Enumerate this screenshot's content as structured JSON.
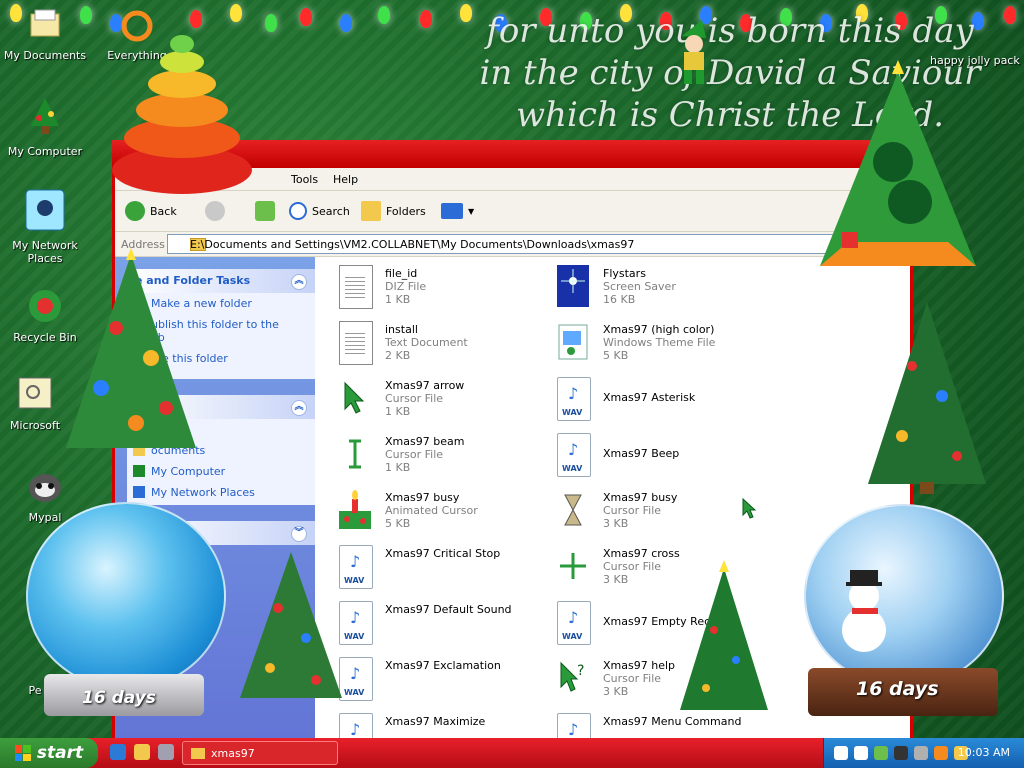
{
  "desktop": {
    "verse_lines": [
      "for unto you is born this day",
      "in the city of David a Saviour",
      "which is Christ the Lord."
    ],
    "jolly_label": "happy jolly pack",
    "icons": [
      {
        "label": "My Documents",
        "icon": "documents-icon"
      },
      {
        "label": "Everything",
        "icon": "everything-icon"
      },
      {
        "label": "My Computer",
        "icon": "computer-icon"
      },
      {
        "label": "My Network Places",
        "icon": "network-icon"
      },
      {
        "label": "Recycle Bin",
        "icon": "recycle-bin-icon"
      },
      {
        "label": "Microsoft",
        "icon": "microsoft-icon"
      },
      {
        "label": "Mypal",
        "icon": "raccoon-icon"
      },
      {
        "label": "Pe",
        "icon": "shortcut-icon"
      }
    ],
    "countdown_left": "16 days",
    "countdown_right": "16 days"
  },
  "window": {
    "menu": [
      "Tools",
      "Help"
    ],
    "toolbar": {
      "back": "Back",
      "search": "Search",
      "folders": "Folders"
    },
    "address_label": "Address",
    "address_value": "E:\\Documents and Settings\\VM2.COLLABNET\\My Documents\\Downloads\\xmas97",
    "tasks": {
      "file_folder_title": "e and Folder Tasks",
      "file_folder_items": [
        "Make a new folder",
        "ublish this folder to the",
        "eb",
        "are this folder"
      ],
      "other_title": "es",
      "other_items": [
        "ads",
        "ocuments",
        "My Computer",
        "My Network Places"
      ]
    },
    "files": [
      {
        "name": "file_id",
        "type": "DIZ File",
        "size": "1 KB",
        "icon": "text-file-icon"
      },
      {
        "name": "Flystars",
        "type": "Screen Saver",
        "size": "16 KB",
        "icon": "screensaver-icon"
      },
      {
        "name": "install",
        "type": "Text Document",
        "size": "2 KB",
        "icon": "text-file-icon"
      },
      {
        "name": "Xmas97 (high color)",
        "type": "Windows Theme File",
        "size": "5 KB",
        "icon": "theme-file-icon"
      },
      {
        "name": "Xmas97 arrow",
        "type": "Cursor File",
        "size": "1 KB",
        "icon": "cursor-arrow-icon"
      },
      {
        "name": "Xmas97 Asterisk",
        "type": "",
        "size": "",
        "icon": "wav-icon"
      },
      {
        "name": "Xmas97 beam",
        "type": "Cursor File",
        "size": "1 KB",
        "icon": "cursor-beam-icon"
      },
      {
        "name": "Xmas97 Beep",
        "type": "",
        "size": "",
        "icon": "wav-icon"
      },
      {
        "name": "Xmas97 busy",
        "type": "Animated Cursor",
        "size": "5 KB",
        "icon": "candle-icon"
      },
      {
        "name": "Xmas97 busy",
        "type": "Cursor File",
        "size": "3 KB",
        "icon": "hourglass-icon"
      },
      {
        "name": "Xmas97 Critical Stop",
        "type": "",
        "size": "",
        "icon": "wav-icon"
      },
      {
        "name": "Xmas97 cross",
        "type": "Cursor File",
        "size": "3 KB",
        "icon": "cross-cursor-icon"
      },
      {
        "name": "Xmas97 Default Sound",
        "type": "",
        "size": "",
        "icon": "wav-icon"
      },
      {
        "name": "Xmas97 Empty Recycle",
        "type": "",
        "size": "",
        "icon": "wav-icon"
      },
      {
        "name": "Xmas97 Exclamation",
        "type": "",
        "size": "",
        "icon": "wav-icon"
      },
      {
        "name": "Xmas97 help",
        "type": "Cursor File",
        "size": "3 KB",
        "icon": "help-cursor-icon"
      },
      {
        "name": "Xmas97 Maximize",
        "type": "",
        "size": "",
        "icon": "wav-icon"
      },
      {
        "name": "Xmas97 Menu Command",
        "type": "",
        "size": "",
        "icon": "wav-icon"
      }
    ],
    "wav_label": "WAV"
  },
  "taskbar": {
    "start_label": "start",
    "task_label": "xmas97",
    "clock": "10:03 AM"
  },
  "colors": {
    "titlebar": "#d40000",
    "taskbar": "#c8141c",
    "start": "#2f8a2f",
    "tray": "#1a6fc4"
  }
}
